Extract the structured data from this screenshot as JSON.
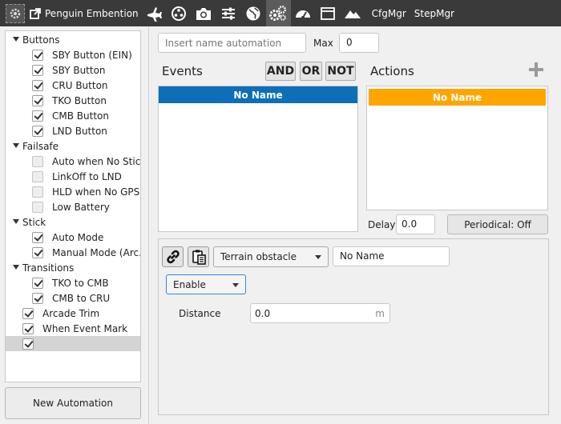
{
  "toolbar": {
    "title": "Penguin Embention",
    "icons": [
      "airplane-icon",
      "nodes-icon",
      "camera-icon",
      "sliders-icon",
      "globe-icon",
      "gears-icon",
      "gauge-icon",
      "window-icon",
      "mountain-icon"
    ],
    "cfgmgr": "CfgMgr",
    "stepmgr": "StepMgr"
  },
  "tree": {
    "groups": [
      {
        "label": "Buttons",
        "items": [
          {
            "label": "SBY Button (EIN)",
            "checked": true
          },
          {
            "label": "SBY Button",
            "checked": true
          },
          {
            "label": "CRU Button",
            "checked": true
          },
          {
            "label": "TKO Button",
            "checked": true
          },
          {
            "label": "CMB Button",
            "checked": true
          },
          {
            "label": "LND Button",
            "checked": true
          }
        ]
      },
      {
        "label": "Failsafe",
        "items": [
          {
            "label": "Auto when No Stick",
            "checked": false
          },
          {
            "label": "LinkOff to LND",
            "checked": false
          },
          {
            "label": "HLD when No GPS",
            "checked": false
          },
          {
            "label": "Low Battery",
            "checked": false
          }
        ]
      },
      {
        "label": "Stick",
        "items": [
          {
            "label": "Auto Mode",
            "checked": true
          },
          {
            "label": "Manual Mode (Arc...",
            "checked": true
          }
        ]
      },
      {
        "label": "Transitions",
        "items": [
          {
            "label": "TKO to CMB",
            "checked": true
          },
          {
            "label": "CMB to CRU",
            "checked": true
          }
        ]
      }
    ],
    "root_items": [
      {
        "label": "Arcade Trim",
        "checked": true
      },
      {
        "label": "When Event Mark",
        "checked": true
      },
      {
        "label": "",
        "checked": true,
        "selected": true
      }
    ]
  },
  "new_automation_label": "New Automation",
  "automation": {
    "name_placeholder": "Insert name automation",
    "max_label": "Max",
    "max_value": "0"
  },
  "events": {
    "title": "Events",
    "and_label": "AND",
    "or_label": "OR",
    "not_label": "NOT",
    "header": "No Name"
  },
  "actions": {
    "title": "Actions",
    "header": "No Name",
    "delay_label": "Delay",
    "delay_value": "0.0",
    "periodical_label": "Periodical: Off"
  },
  "action_detail": {
    "type_value": "Terrain obstacle",
    "name_value": "No Name",
    "enable_value": "Enable",
    "distance_label": "Distance",
    "distance_value": "0.0",
    "distance_unit": "m"
  },
  "colors": {
    "events_header": "#0d6fb8",
    "actions_header": "#ffa500",
    "topbar": "#3a3a3a"
  }
}
